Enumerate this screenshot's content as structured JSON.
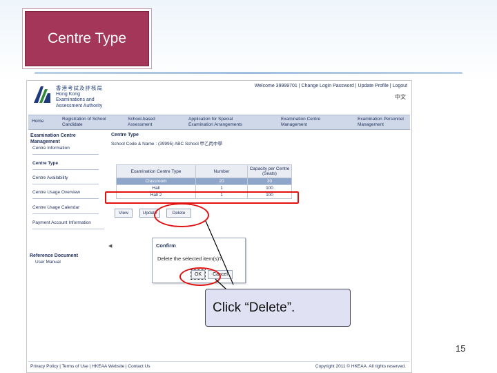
{
  "slide": {
    "title": "Centre Type",
    "callout": "Click “Delete”.",
    "page_number": "15"
  },
  "header": {
    "org_cn": "香港考試及評核局",
    "org_en_1": "Hong Kong",
    "org_en_2": "Examinations and",
    "org_en_3": "Assessment Authority",
    "top_links": "Welcome 39999701 | Change Login Password | Update Profile | Logout",
    "lang_link": "中文"
  },
  "topnav": [
    {
      "label": "Home"
    },
    {
      "label": "Registration of School Candidate"
    },
    {
      "label": "School-based Assessment"
    },
    {
      "label": "Application for Special Examination Arrangements"
    },
    {
      "label": "Examination Centre Management"
    },
    {
      "label": "Examination Personnel Management"
    }
  ],
  "sidebar": {
    "heading": "Examination Centre Management",
    "items": [
      {
        "label": "Centre Information"
      },
      {
        "label": "Centre Type"
      },
      {
        "label": "Centre Availability"
      },
      {
        "label": "Centre Usage Overview"
      },
      {
        "label": "Centre Usage Calendar"
      },
      {
        "label": "Payment Account Information"
      }
    ],
    "ref_heading": "Reference Document",
    "ref_item": "User Manual"
  },
  "main": {
    "heading": "Centre Type",
    "school_label": "School Code & Name :",
    "school_code": "(39995)",
    "school_name": "ABC School",
    "school_name_cn": "甲乙丙中學",
    "table": {
      "headers": [
        "Examination Centre Type",
        "Number",
        "Capacity per Centre (Seats)"
      ],
      "rows": [
        {
          "type": "Classroom",
          "number": "20",
          "capacity": "30"
        },
        {
          "type": "Hall",
          "number": "1",
          "capacity": "100"
        },
        {
          "type": "Hall 2",
          "number": "1",
          "capacity": "100"
        }
      ]
    },
    "buttons": {
      "view": "View",
      "update": "Update",
      "delete": "Delete"
    }
  },
  "dialog": {
    "title": "Confirm",
    "message": "Delete the selected item(s)?",
    "ok": "OK",
    "cancel": "Cancel"
  },
  "footer": {
    "links": "Privacy Policy | Terms of Use | HKEAA Website | Contact Us",
    "copyright": "Copyright 2011 © HKEAA. All rights reserved."
  },
  "colors": {
    "title_bg": "#a4365a",
    "highlight_red": "#e01010",
    "callout_bg": "#e0e2f4",
    "nav_bg": "#cfd8e8",
    "selected_row": "#8ea6c9"
  }
}
